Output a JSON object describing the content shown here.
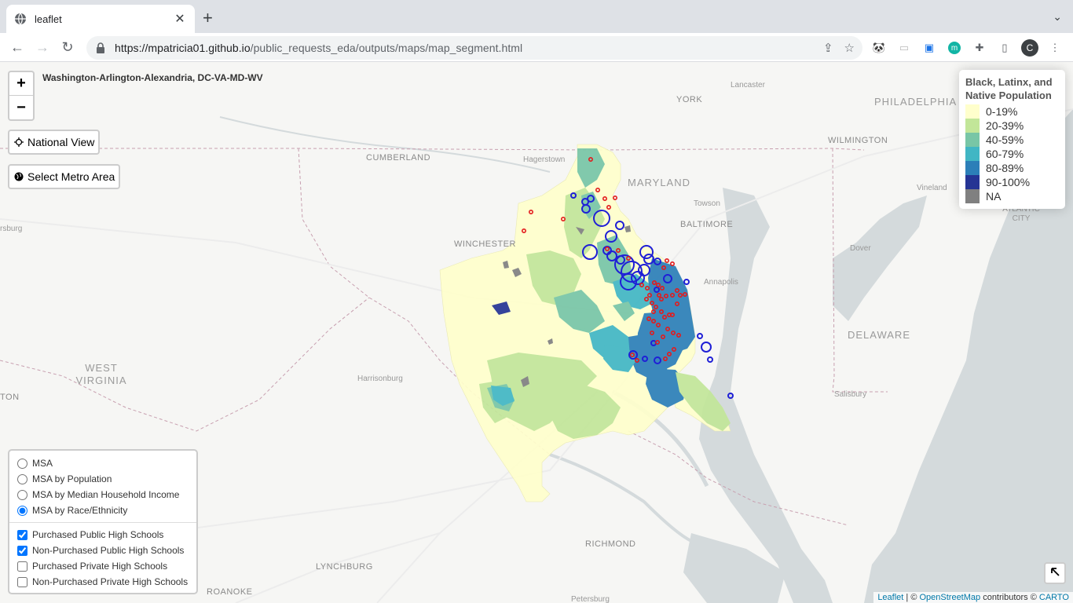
{
  "browser": {
    "tab_title": "leaflet",
    "url_host": "https://mpatricia01.github.io",
    "url_path": "/public_requests_eda/outputs/maps/map_segment.html",
    "avatar_letter": "C"
  },
  "map": {
    "msa_title": "Washington-Arlington-Alexandria, DC-VA-MD-WV",
    "zoom_in_label": "+",
    "zoom_out_label": "−",
    "national_view_label": "National View",
    "select_metro_label": "Select Metro Area",
    "labels": {
      "york": "YORK",
      "lancaster": "Lancaster",
      "philadelphia": "PHILADELPHIA",
      "cumberland": "CUMBERLAND",
      "hagerstown": "Hagerstown",
      "maryland": "MARYLAND",
      "wilmington": "WILMINGTON",
      "vineland": "Vineland",
      "towson": "Towson",
      "baltimore": "BALTIMORE",
      "atlantic_city": "ATLANTIC CITY",
      "winchester": "WINCHESTER",
      "burg": "rsburg",
      "dover": "Dover",
      "annapolis": "Annapolis",
      "west_virginia": "WEST VIRGINIA",
      "delaware": "DELAWARE",
      "harrisonburg": "Harrisonburg",
      "ton": "TON",
      "salisbury": "Salisbury",
      "richmond": "RICHMOND",
      "lynchburg": "LYNCHBURG",
      "roanoke": "ROANOKE",
      "petersburg": "Petersburg"
    },
    "attribution": {
      "leaflet": "Leaflet",
      "sep": " | © ",
      "osm": "OpenStreetMap",
      "contributors": " contributors © ",
      "carto": "CARTO"
    }
  },
  "legend": {
    "title": "Black, Latinx, and Native Population",
    "items": [
      {
        "label": "0-19%",
        "color": "#ffffcc"
      },
      {
        "label": "20-39%",
        "color": "#c2e699"
      },
      {
        "label": "40-59%",
        "color": "#78c6a6"
      },
      {
        "label": "60-79%",
        "color": "#41b6c4"
      },
      {
        "label": "80-89%",
        "color": "#2c7fb8"
      },
      {
        "label": "90-100%",
        "color": "#253494"
      },
      {
        "label": "NA",
        "color": "#808080"
      }
    ]
  },
  "layers": {
    "base": [
      {
        "label": "MSA",
        "checked": false
      },
      {
        "label": "MSA by Population",
        "checked": false
      },
      {
        "label": "MSA by Median Household Income",
        "checked": false
      },
      {
        "label": "MSA by Race/Ethnicity",
        "checked": true
      }
    ],
    "overlays": [
      {
        "label": "Purchased Public High Schools",
        "checked": true
      },
      {
        "label": "Non-Purchased Public High Schools",
        "checked": true
      },
      {
        "label": "Purchased Private High Schools",
        "checked": false
      },
      {
        "label": "Non-Purchased Private High Schools",
        "checked": false
      }
    ]
  },
  "colors": {
    "purchased_marker": "#e31a1c",
    "non_purchased_marker": "#1f1fd6",
    "water": "#d4dadc",
    "land": "#f6f6f4"
  }
}
